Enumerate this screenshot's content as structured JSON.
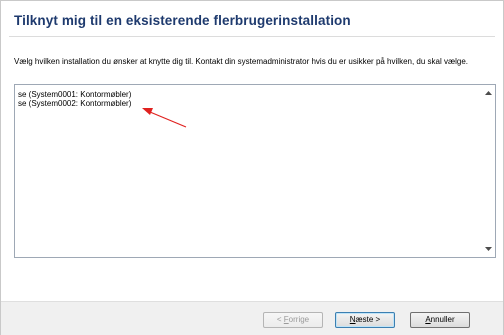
{
  "dialog": {
    "title": "Tilknyt mig til en eksisterende flerbrugerinstallation",
    "instruction": "Vælg hvilken installation du ønsker at knytte dig til. Kontakt din systemadministrator hvis du er usikker på hvilken, du skal vælge."
  },
  "installations": [
    {
      "label": "se (System0001: Kontormøbler)"
    },
    {
      "label": "se (System0002: Kontormøbler)"
    }
  ],
  "buttons": {
    "back": {
      "label_pre": "< ",
      "mnemonic": "F",
      "label_post": "orrige",
      "enabled": false
    },
    "next": {
      "label_pre": "",
      "mnemonic": "N",
      "label_post": "æste >",
      "enabled": true
    },
    "cancel": {
      "label_pre": "",
      "mnemonic": "A",
      "label_post": "nnuller",
      "enabled": true
    }
  },
  "colors": {
    "title": "#1e3a6e",
    "annotation_arrow": "#e0211f",
    "footer_bg": "#f0f0f0"
  },
  "icons": {
    "scroll_up": "triangle-up",
    "scroll_down": "triangle-down",
    "annotation": "red-arrow"
  }
}
